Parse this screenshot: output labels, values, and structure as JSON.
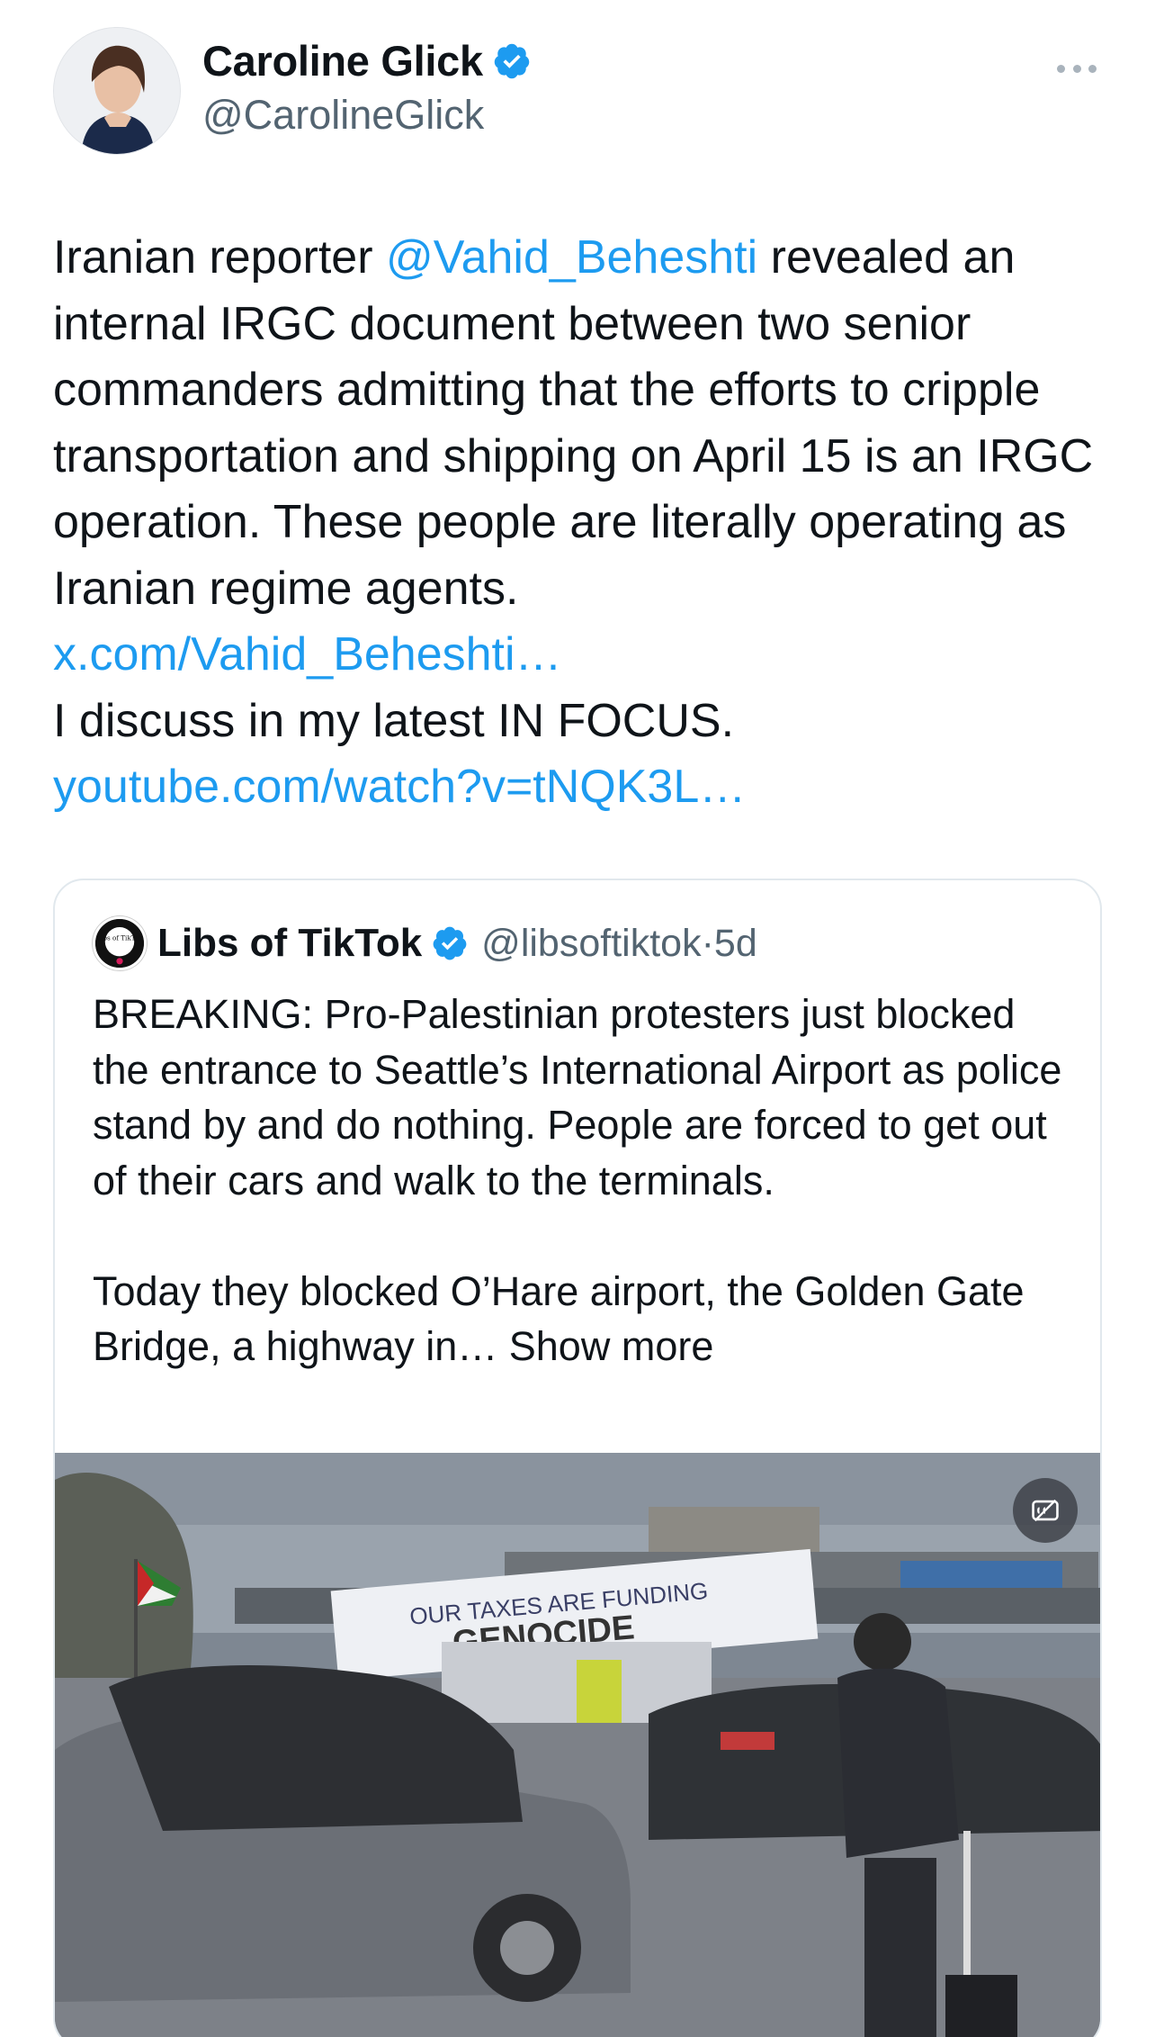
{
  "author": {
    "name": "Caroline Glick",
    "handle": "@CarolineGlick"
  },
  "tweet": {
    "line1_a": "Iranian reporter ",
    "mention": "@Vahid_Beheshti",
    "line1_b": " revealed an internal IRGC document between two senior commanders admitting that the efforts to cripple transportation and shipping on April 15 is an IRGC operation. These people are literally operating as Iranian regime agents.",
    "link1": "x.com/Vahid_Beheshti…",
    "line2": "I discuss in my latest IN FOCUS.",
    "link2": "youtube.com/watch?v=tNQK3L…"
  },
  "quoted": {
    "avatar_text": "Libs of TikTok",
    "name": "Libs of TikTok",
    "handle": "@libsoftiktok",
    "separator": "·",
    "age": "5d",
    "para1": "BREAKING: Pro-Palestinian protesters just blocked the entrance to Seattle’s International Airport as police stand by and do nothing. People are forced to get out of their cars and walk to the terminals.",
    "para2": "Today they blocked O’Hare airport, the Golden Gate Bridge, a highway in…",
    "show_more": "Show more",
    "media": {
      "banner_line1": "OUR TAXES ARE FUNDING",
      "banner_line2": "GENOCIDE"
    }
  },
  "colors": {
    "link": "#1d9bf0",
    "verified": "#1d9bf0",
    "secondary_text": "#536471"
  }
}
